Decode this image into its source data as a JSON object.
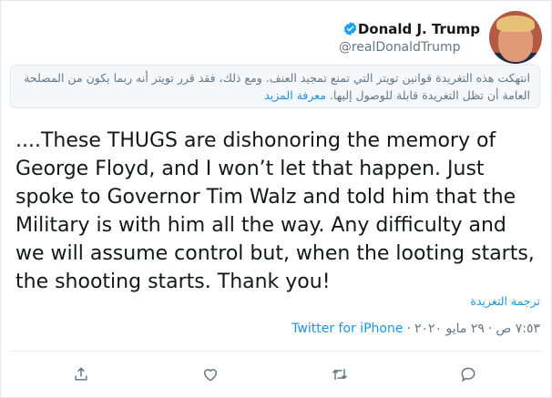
{
  "author": {
    "name": "Donald J. Trump",
    "handle": "@realDonaldTrump"
  },
  "notice": {
    "text": "انتهكت هذه التغريدة قوانين تويتر التي تمنع تمجيد العنف. ومع ذلك، فقد قرر تويتر أنه ربما يكون من المصلحة العامة أن تظل التغريدة قابلة للوصول إليها.",
    "learn_more": "معرفة المزيد"
  },
  "tweet": {
    "text": "....These THUGS are dishonoring the memory of George Floyd, and I won’t let that happen. Just spoke to Governor Tim Walz and told him that the Military is with him all the way. Any difficulty and we will assume control but, when the looting starts, the shooting starts. Thank you!"
  },
  "translate_label": "ترجمة التغريدة",
  "meta": {
    "time": "٧:٥٣ ص",
    "sep1": "·",
    "date": "٢٩ مايو ٢٠٢٠",
    "sep2": "·",
    "source": "Twitter for iPhone"
  },
  "actions": {
    "icons": [
      "reply-icon",
      "retweet-icon",
      "like-icon",
      "share-icon"
    ]
  },
  "colors": {
    "accent": "#1b95e0",
    "muted": "#657786",
    "notice_bg": "#f5f8fa"
  }
}
